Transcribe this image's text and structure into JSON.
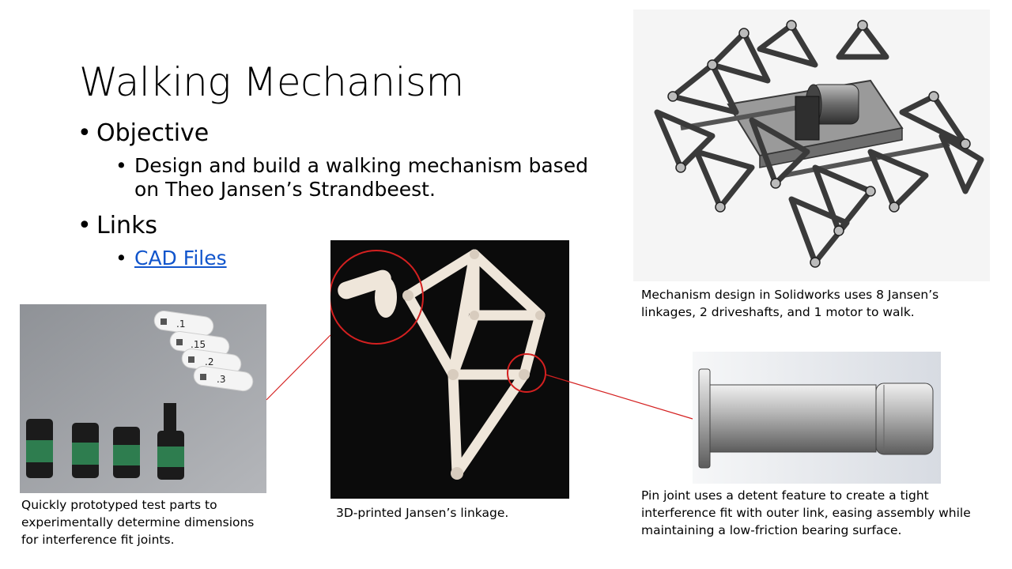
{
  "slide": {
    "title": "Walking Mechanism",
    "bullets": {
      "objective_heading": "Objective",
      "objective_text_line1": "Design and build a walking mechanism based",
      "objective_text_line2": "on Theo Jansen’s Strandbeest.",
      "links_heading": "Links",
      "cad_link": "CAD Files"
    },
    "captions": {
      "solidworks": "Mechanism design in Solidworks uses 8 Jansen’s linkages, 2 driveshafts, and 1 motor to walk.",
      "test_parts": "Quickly prototyped test parts to experimentally determine dimensions for interference fit joints.",
      "linkage": "3D-printed Jansen’s linkage.",
      "pin_joint": "Pin joint uses a detent feature to create a tight interference fit with outer link, easing assembly while maintaining a low-friction bearing surface."
    },
    "test_part_labels": [
      ".1",
      ".15",
      ".2",
      ".3"
    ],
    "colors": {
      "link_blue": "#1155cc",
      "callout_red": "#d42020",
      "linkage_white": "#efe6da",
      "photo_black": "#0b0b0b"
    },
    "icons": [
      "bullet-dot",
      "cad-render",
      "photo-test-parts",
      "photo-linkage",
      "pin-render"
    ]
  }
}
